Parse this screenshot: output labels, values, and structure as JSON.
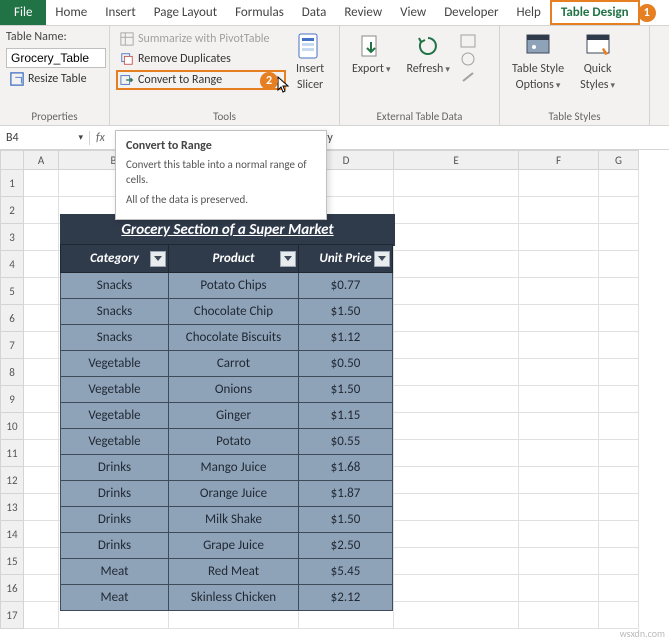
{
  "tabs": {
    "file": "File",
    "home": "Home",
    "insert": "Insert",
    "page_layout": "Page Layout",
    "formulas": "Formulas",
    "data": "Data",
    "review": "Review",
    "view": "View",
    "developer": "Developer",
    "help": "Help",
    "table_design": "Table Design"
  },
  "badges": {
    "one": "1",
    "two": "2"
  },
  "ribbon": {
    "properties": {
      "label": "Table Name:",
      "value": "Grocery_Table",
      "resize": "Resize Table",
      "group": "Properties"
    },
    "tools": {
      "pivot": "Summarize with PivotTable",
      "dupes": "Remove Duplicates",
      "convert": "Convert to Range",
      "slicer_l1": "Insert",
      "slicer_l2": "Slicer",
      "group": "Tools"
    },
    "external": {
      "export": "Export",
      "refresh": "Refresh",
      "group": "External Table Data"
    },
    "styles": {
      "options_l1": "Table Style",
      "options_l2": "Options",
      "quick_l1": "Quick",
      "quick_l2": "Styles",
      "group": "Table Styles"
    }
  },
  "tooltip": {
    "title": "Convert to Range",
    "line1": "Convert this table into a normal range of cells.",
    "line2": "All of the data is preserved."
  },
  "fx": {
    "name": "B4",
    "value": "ory"
  },
  "cols": [
    "A",
    "B",
    "C",
    "D",
    "E",
    "F",
    "G"
  ],
  "rows": [
    "1",
    "2",
    "3",
    "4",
    "5",
    "6",
    "7",
    "8",
    "9",
    "10",
    "11",
    "12",
    "13",
    "14",
    "15",
    "16",
    "17"
  ],
  "title": "Grocery Section of a Super Market",
  "headers": {
    "cat": "Category",
    "prod": "Product",
    "price": "Unit Price"
  },
  "table": [
    {
      "cat": "Snacks",
      "prod": "Potato Chips",
      "price": "$0.77"
    },
    {
      "cat": "Snacks",
      "prod": "Chocolate Chip",
      "price": "$1.50"
    },
    {
      "cat": "Snacks",
      "prod": "Chocolate Biscuits",
      "price": "$1.12"
    },
    {
      "cat": "Vegetable",
      "prod": "Carrot",
      "price": "$0.50"
    },
    {
      "cat": "Vegetable",
      "prod": "Onions",
      "price": "$1.50"
    },
    {
      "cat": "Vegetable",
      "prod": "Ginger",
      "price": "$1.15"
    },
    {
      "cat": "Vegetable",
      "prod": "Potato",
      "price": "$0.55"
    },
    {
      "cat": "Drinks",
      "prod": "Mango Juice",
      "price": "$1.68"
    },
    {
      "cat": "Drinks",
      "prod": "Orange Juice",
      "price": "$1.87"
    },
    {
      "cat": "Drinks",
      "prod": "Milk Shake",
      "price": "$1.50"
    },
    {
      "cat": "Drinks",
      "prod": "Grape Juice",
      "price": "$2.50"
    },
    {
      "cat": "Meat",
      "prod": "Red Meat",
      "price": "$5.45"
    },
    {
      "cat": "Meat",
      "prod": "Skinless Chicken",
      "price": "$2.12"
    }
  ],
  "watermark": "wsxdn.com"
}
